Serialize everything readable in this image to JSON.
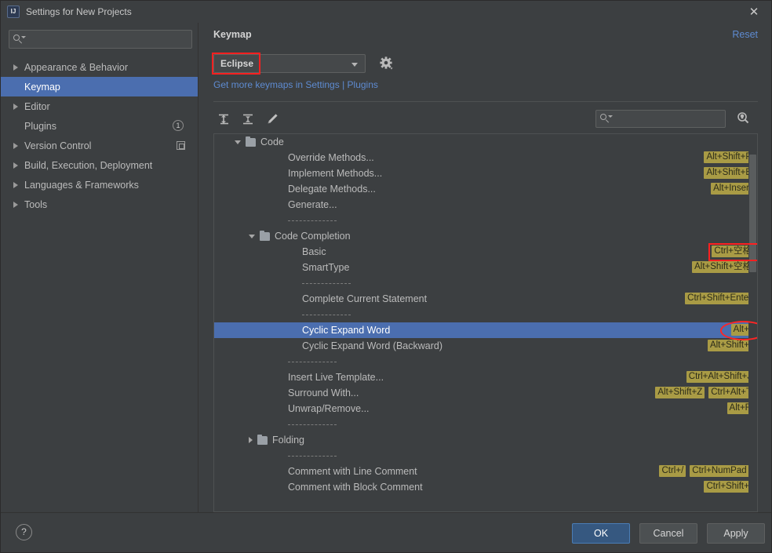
{
  "window": {
    "title": "Settings for New Projects",
    "app_icon_label": "IJ",
    "close_icon": "close-icon"
  },
  "sidebar": {
    "search": {
      "value": "",
      "placeholder": ""
    },
    "items": [
      {
        "label": "Appearance & Behavior",
        "expandable": true,
        "selected": false
      },
      {
        "label": "Keymap",
        "expandable": false,
        "selected": true
      },
      {
        "label": "Editor",
        "expandable": true,
        "selected": false
      },
      {
        "label": "Plugins",
        "expandable": false,
        "selected": false,
        "badge_count": "1"
      },
      {
        "label": "Version Control",
        "expandable": true,
        "selected": false,
        "badge_icon": "copy-icon"
      },
      {
        "label": "Build, Execution, Deployment",
        "expandable": true,
        "selected": false
      },
      {
        "label": "Languages & Frameworks",
        "expandable": true,
        "selected": false
      },
      {
        "label": "Tools",
        "expandable": true,
        "selected": false
      }
    ]
  },
  "content": {
    "panel_title": "Keymap",
    "reset_label": "Reset",
    "keymap_select": {
      "value": "Eclipse",
      "highlighted": true
    },
    "gear_icon": "gear-icon",
    "plugins_link": "Get more keymaps in Settings | Plugins",
    "toolbar": [
      {
        "name": "expand-all-icon"
      },
      {
        "name": "collapse-all-icon"
      },
      {
        "name": "edit-pencil-icon"
      }
    ],
    "tree_search": {
      "value": "",
      "placeholder": ""
    },
    "shortcut_search_icon": "find-by-shortcut-icon"
  },
  "tree": [
    {
      "type": "folder",
      "label": "Code",
      "indent": 0,
      "open": true
    },
    {
      "type": "item",
      "label": "Override Methods...",
      "indent": 1,
      "shortcuts": [
        "Alt+Shift+P"
      ]
    },
    {
      "type": "item",
      "label": "Implement Methods...",
      "indent": 1,
      "shortcuts": [
        "Alt+Shift+E"
      ]
    },
    {
      "type": "item",
      "label": "Delegate Methods...",
      "indent": 1,
      "shortcuts": [
        "Alt+Insert"
      ]
    },
    {
      "type": "item",
      "label": "Generate...",
      "indent": 1,
      "shortcuts": []
    },
    {
      "type": "separator",
      "indent": 1
    },
    {
      "type": "folder",
      "label": "Code Completion",
      "indent": 1,
      "open": true
    },
    {
      "type": "item",
      "label": "Basic",
      "indent": 2,
      "shortcuts": [
        "Ctrl+空格"
      ],
      "highlight": "box"
    },
    {
      "type": "item",
      "label": "SmartType",
      "indent": 2,
      "shortcuts": [
        "Alt+Shift+空格"
      ]
    },
    {
      "type": "separator",
      "indent": 2
    },
    {
      "type": "item",
      "label": "Complete Current Statement",
      "indent": 2,
      "shortcuts": [
        "Ctrl+Shift+Enter"
      ]
    },
    {
      "type": "separator",
      "indent": 2
    },
    {
      "type": "item",
      "label": "Cyclic Expand Word",
      "indent": 2,
      "shortcuts": [
        "Alt+/"
      ],
      "selected": true,
      "highlight": "ellipse"
    },
    {
      "type": "item",
      "label": "Cyclic Expand Word (Backward)",
      "indent": 2,
      "shortcuts": [
        "Alt+Shift+/"
      ]
    },
    {
      "type": "separator",
      "indent": 1
    },
    {
      "type": "item",
      "label": "Insert Live Template...",
      "indent": 1,
      "shortcuts": [
        "Ctrl+Alt+Shift+J"
      ]
    },
    {
      "type": "item",
      "label": "Surround With...",
      "indent": 1,
      "shortcuts": [
        "Alt+Shift+Z",
        "Ctrl+Alt+T"
      ]
    },
    {
      "type": "item",
      "label": "Unwrap/Remove...",
      "indent": 1,
      "shortcuts": [
        "Alt+R"
      ]
    },
    {
      "type": "separator",
      "indent": 1
    },
    {
      "type": "folder",
      "label": "Folding",
      "indent": 1,
      "open": false
    },
    {
      "type": "separator",
      "indent": 1
    },
    {
      "type": "item",
      "label": "Comment with Line Comment",
      "indent": 1,
      "shortcuts": [
        "Ctrl+/",
        "Ctrl+NumPad /"
      ]
    },
    {
      "type": "item",
      "label": "Comment with Block Comment",
      "indent": 1,
      "shortcuts": [
        "Ctrl+Shift+/"
      ]
    }
  ],
  "footer": {
    "help_label": "?",
    "ok_label": "OK",
    "cancel_label": "Cancel",
    "apply_label": "Apply"
  },
  "colors": {
    "background": "#3c3f41",
    "selection": "#4b6eaf",
    "link": "#5e8bd1",
    "shortcut_badge": "#a99b45",
    "highlight": "#ff2020",
    "ok_button": "#365880"
  }
}
